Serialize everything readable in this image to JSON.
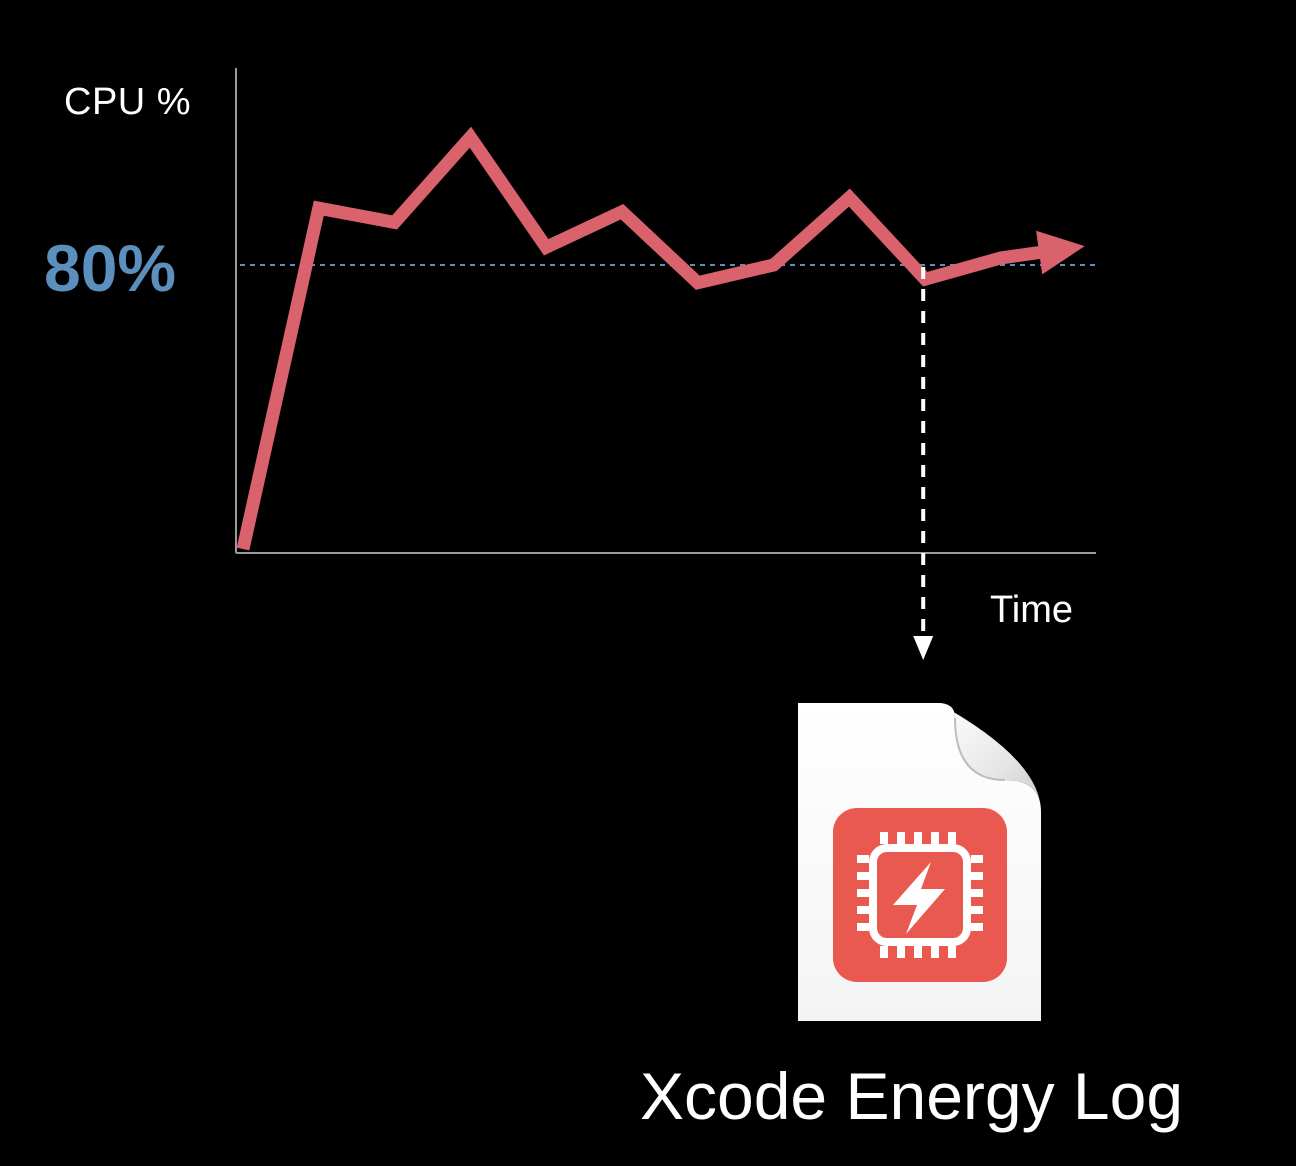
{
  "chart_data": {
    "type": "line",
    "ylabel": "CPU %",
    "xlabel": "Time",
    "threshold": {
      "label": "80%",
      "value": 80
    },
    "series": [
      {
        "points": [
          [
            0,
            0
          ],
          [
            1,
            96
          ],
          [
            2,
            92
          ],
          [
            3,
            116
          ],
          [
            4,
            85
          ],
          [
            5,
            95
          ],
          [
            6,
            75
          ],
          [
            7,
            80
          ],
          [
            8,
            99
          ],
          [
            9,
            76
          ],
          [
            10,
            82
          ],
          [
            11,
            85
          ]
        ]
      }
    ],
    "ylim": [
      0,
      120
    ],
    "xlim": [
      0,
      11.5
    ]
  },
  "document": {
    "title": "Xcode Energy Log"
  },
  "colors": {
    "background": "#000000",
    "line": "#d9626d",
    "threshold": "#5b8fbd",
    "axis": "#9a9a9a",
    "icon_red": "#e9594f",
    "text": "#ffffff"
  }
}
